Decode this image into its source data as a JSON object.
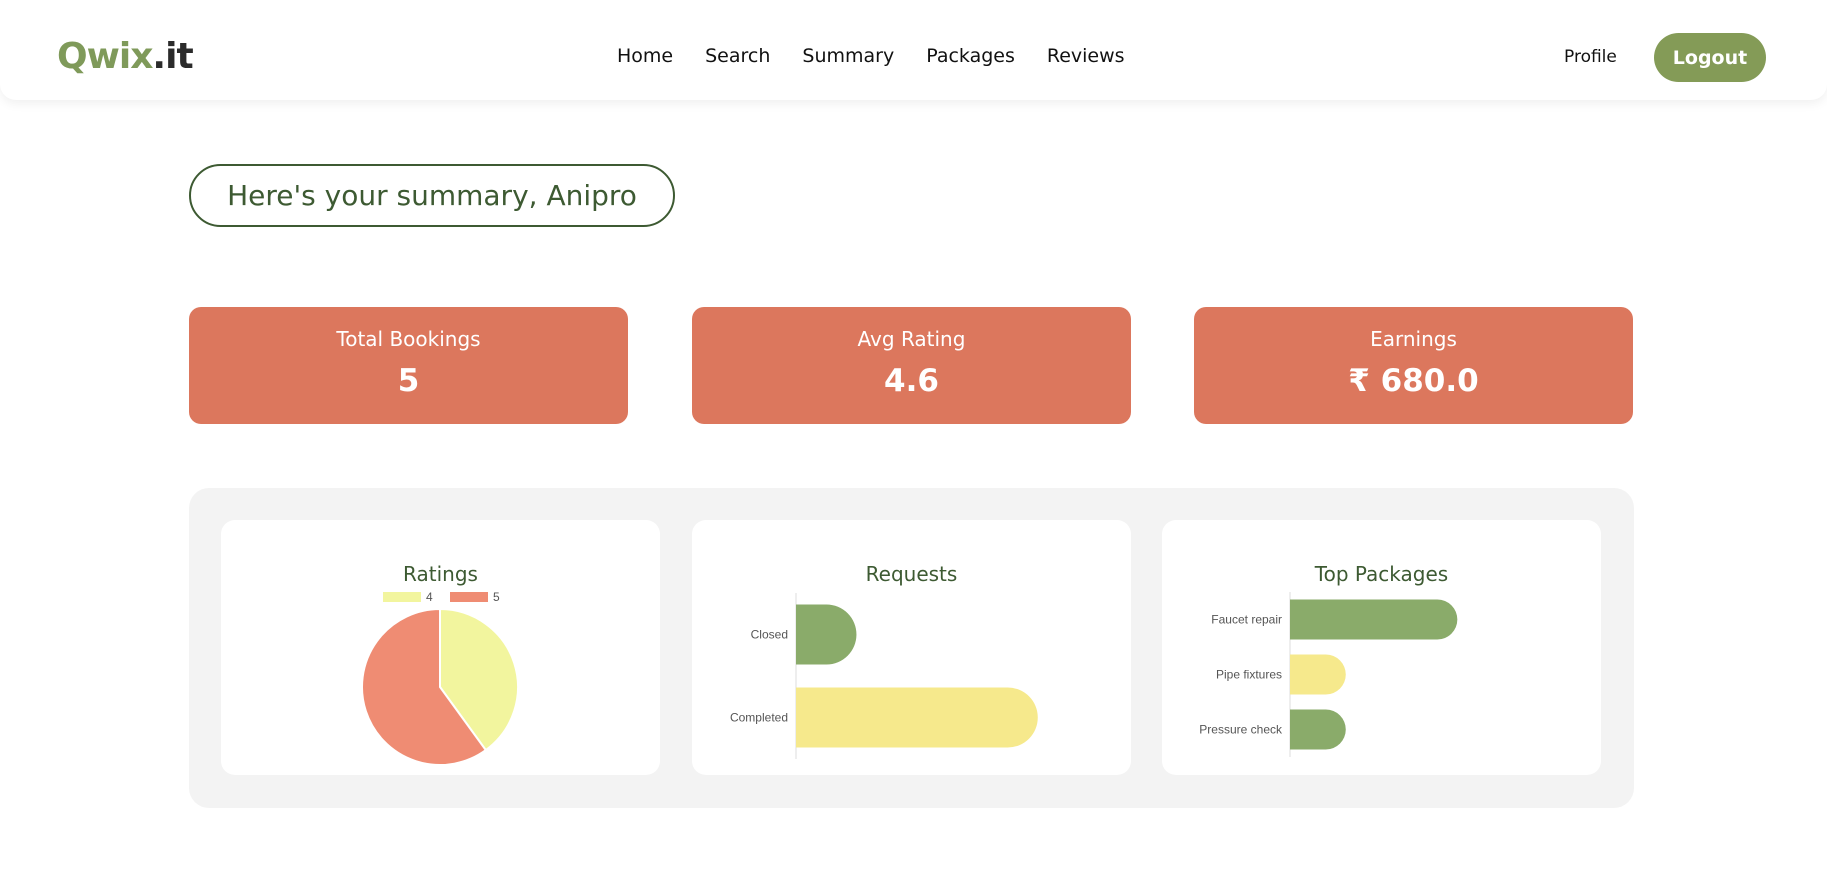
{
  "header": {
    "logo_brand": "Qwix",
    "logo_tld": ".it",
    "nav": [
      "Home",
      "Search",
      "Summary",
      "Packages",
      "Reviews"
    ],
    "profile_label": "Profile",
    "logout_label": "Logout"
  },
  "greeting": "Here's your summary, Anipro",
  "stats": [
    {
      "label": "Total Bookings",
      "value": "5"
    },
    {
      "label": "Avg Rating",
      "value": "4.6"
    },
    {
      "label": "Earnings",
      "value": "₹ 680.0"
    }
  ],
  "colors": {
    "accent_green": "#849b57",
    "card_orange": "#dc775d",
    "bar_green": "#8aab6a",
    "bar_yellow": "#f6e98c",
    "pie_yellow": "#f2f59e",
    "pie_salmon": "#ef8c73"
  },
  "chart_data": [
    {
      "type": "pie",
      "title": "Ratings",
      "categories": [
        "4",
        "5"
      ],
      "values": [
        2,
        3
      ],
      "legend": "top",
      "colors": [
        "#f2f59e",
        "#ef8c73"
      ]
    },
    {
      "type": "bar",
      "orientation": "horizontal",
      "title": "Requests",
      "categories": [
        "Closed",
        "Completed"
      ],
      "values": [
        1,
        4
      ],
      "xlim": [
        0,
        4.5
      ],
      "colors": [
        "#8aab6a",
        "#f6e98c"
      ]
    },
    {
      "type": "bar",
      "orientation": "horizontal",
      "title": "Top Packages",
      "categories": [
        "Faucet repair",
        "Pipe fixtures",
        "Pressure check"
      ],
      "values": [
        3,
        1,
        1
      ],
      "xlim": [
        0,
        4.5
      ],
      "colors": [
        "#8aab6a",
        "#f6e98c",
        "#8aab6a"
      ]
    }
  ]
}
